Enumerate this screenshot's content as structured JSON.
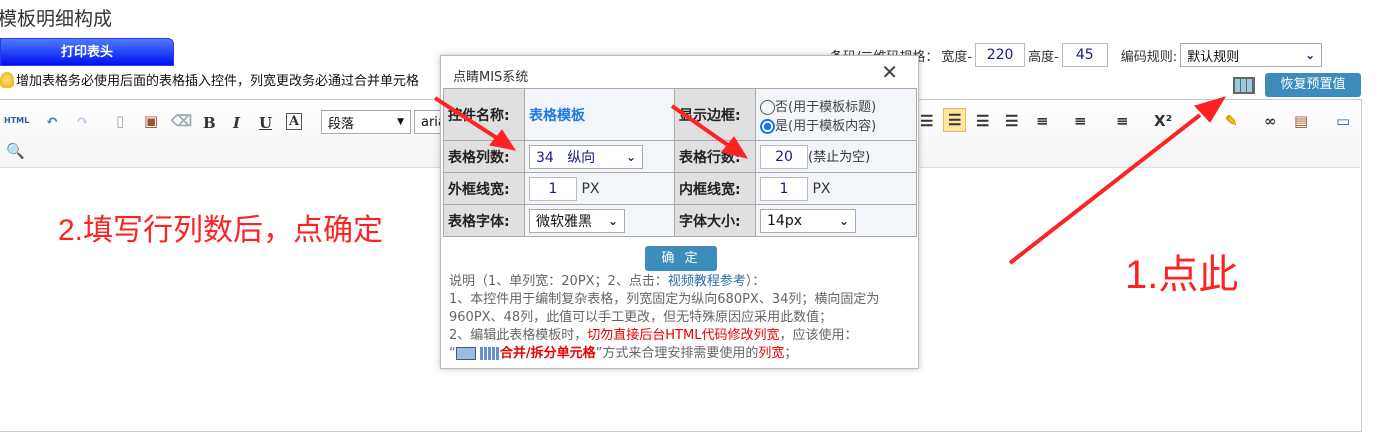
{
  "page": {
    "title": "模板明细构成",
    "print_tab": "打印表头",
    "tip": "增加表格务必使用后面的表格插入控件，列宽更改务必通过合并单元格"
  },
  "barcode": {
    "label": "条码/二维码规格：",
    "width_label": "宽度-",
    "width": "220",
    "height_label": "高度-",
    "height": "45",
    "rule_label": "编码规则:",
    "rule": "默认规则"
  },
  "toolbar": {
    "html": "HTML",
    "bold": "B",
    "italic": "I",
    "underline": "U",
    "fontbox": "A",
    "paragraph": "段落",
    "font": "arial",
    "restore": "恢复预置值",
    "superscript": "X²"
  },
  "dialog": {
    "title": "点睛MIS系统",
    "control_name_label": "控件名称:",
    "control_name": "表格模板",
    "border_label": "显示边框:",
    "border_no": "否(用于模板标题)",
    "border_yes": "是(用于模板内容)",
    "cols_label": "表格列数:",
    "cols": "34",
    "orientation": "纵向",
    "rows_label": "表格行数:",
    "rows": "20",
    "rows_note": "(禁止为空)",
    "outer_label": "外框线宽:",
    "outer": "1",
    "outer_unit": "PX",
    "inner_label": "内框线宽:",
    "inner": "1",
    "inner_unit": "PX",
    "font_label": "表格字体:",
    "font": "微软雅黑",
    "size_label": "字体大小:",
    "size": "14px",
    "ok": "确 定",
    "note_head_a": "说明（1、单列宽：20PX；2、点击：",
    "note_head_link": "视频教程参考",
    "note_head_b": "）：",
    "note1": "1、本控件用于编制复杂表格，列宽固定为纵向680PX、34列；横向固定为960PX、48列，此值可以手工更改，但无特殊原因应采用此数值；",
    "note2_a": "2、编辑此表格模板时，",
    "note2_red": "切勿直接后台HTML代码修改列宽",
    "note2_b": "，应该使用：",
    "note3_a": "“",
    "note3_red": "合并/拆分单元格",
    "note3_b": "”方式来合理安排需要使用的",
    "note3_red2": "列宽",
    "note3_c": "；"
  },
  "annotations": {
    "step2": "2.填写行列数后，点确定",
    "step1": "1.点此"
  }
}
